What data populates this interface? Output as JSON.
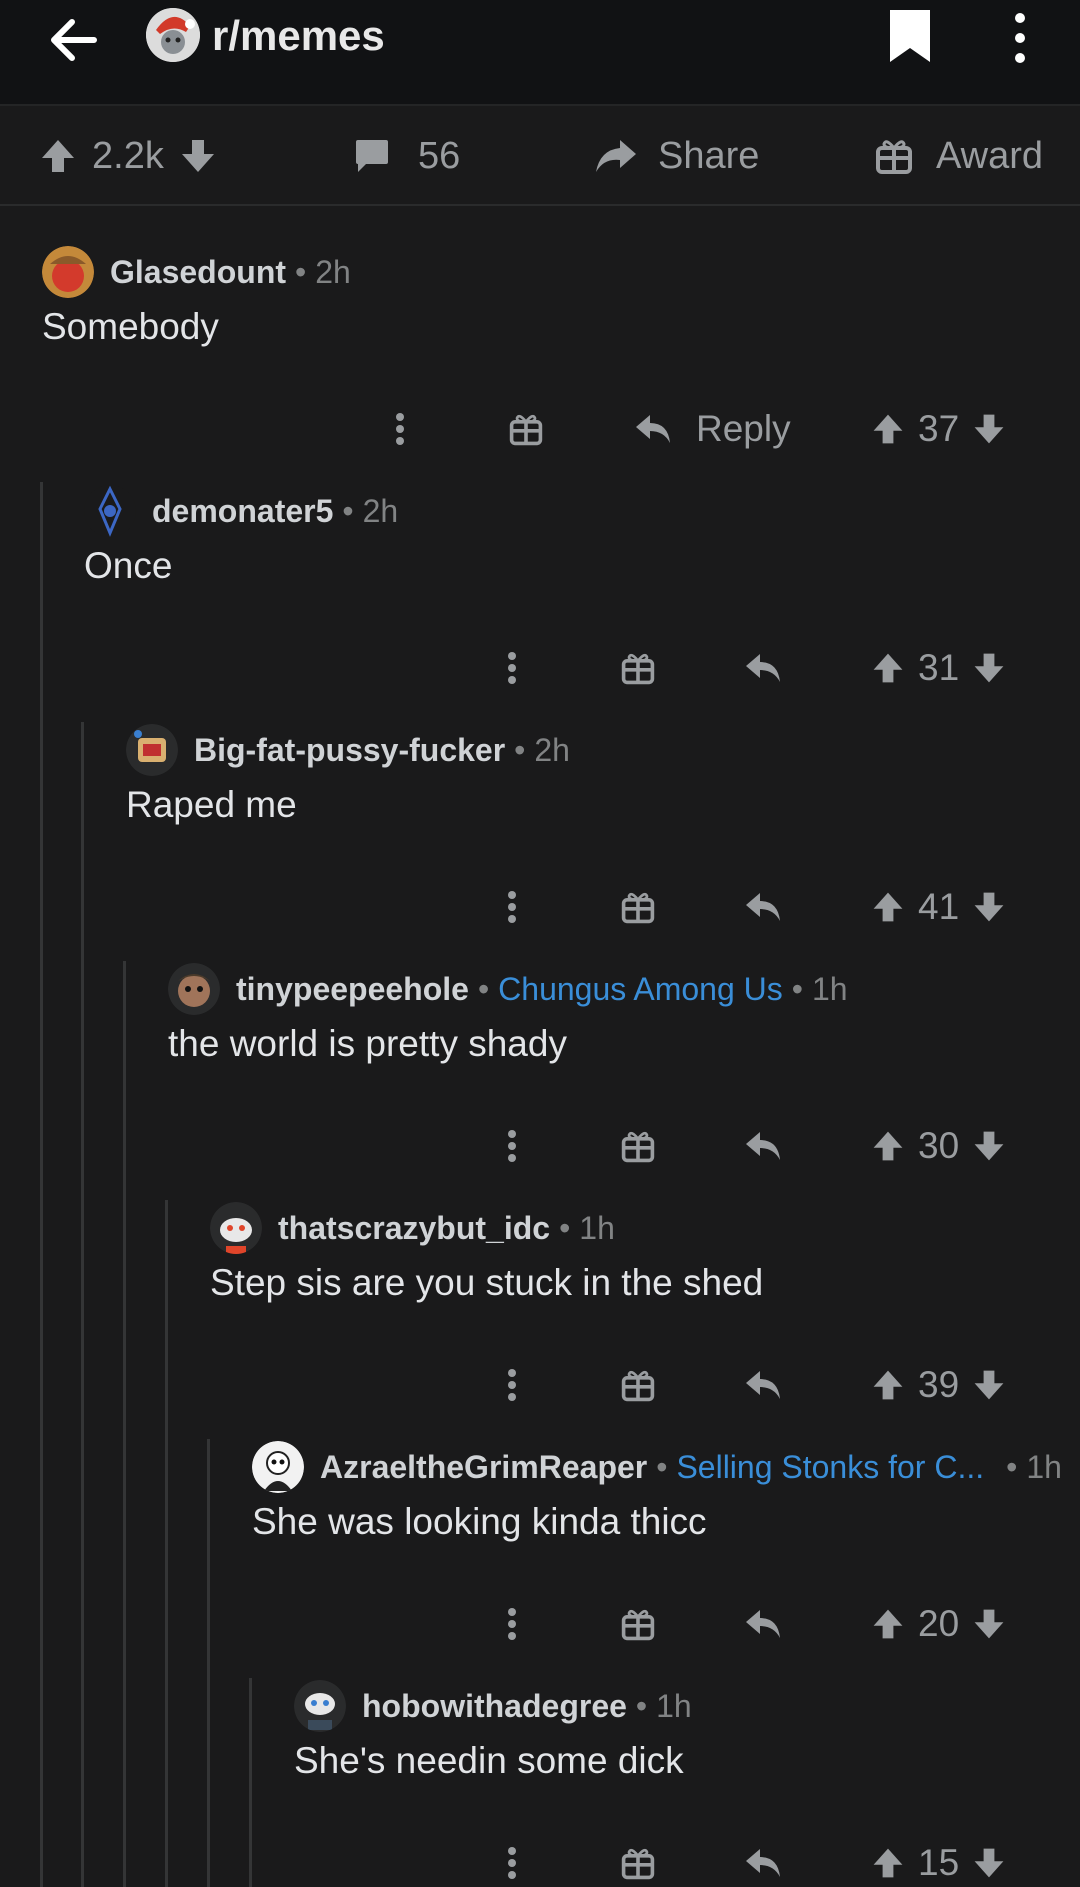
{
  "header": {
    "subreddit": "r/memes"
  },
  "post_actions": {
    "votes": "2.2k",
    "comments": "56",
    "share_label": "Share",
    "award_label": "Award"
  },
  "comments": [
    {
      "user": "Glasedount",
      "time": "2h",
      "flair": "",
      "body": "Somebody",
      "reply_label": "Reply",
      "score": "37"
    },
    {
      "user": "demonater5",
      "time": "2h",
      "flair": "",
      "body": "Once",
      "reply_label": "",
      "score": "31"
    },
    {
      "user": "Big-fat-pussy-fucker",
      "time": "2h",
      "flair": "",
      "body": "Raped me",
      "reply_label": "",
      "score": "41"
    },
    {
      "user": "tinypeepeehole",
      "time": "1h",
      "flair": "Chungus Among Us",
      "body": "the world is pretty shady",
      "reply_label": "",
      "score": "30"
    },
    {
      "user": "thatscrazybut_idc",
      "time": "1h",
      "flair": "",
      "body": "Step sis are you stuck in the shed",
      "reply_label": "",
      "score": "39"
    },
    {
      "user": "AzraeltheGrimReaper",
      "time": "1h",
      "flair": "Selling Stonks for C...",
      "body": "She was looking kinda thicc",
      "reply_label": "",
      "score": "20"
    },
    {
      "user": "hobowithadegree",
      "time": "1h",
      "flair": "",
      "body": "She's needin some dick",
      "reply_label": "",
      "score": "15"
    }
  ],
  "colors": {
    "background": "#1a1a1b",
    "topbar": "#111214",
    "flair": "#3a8ed8",
    "muted": "#818384"
  },
  "icons": [
    "back-arrow-icon",
    "bookmark-icon",
    "more-vertical-icon",
    "upvote-icon",
    "downvote-icon",
    "comment-icon",
    "share-icon",
    "award-icon",
    "reply-icon"
  ]
}
